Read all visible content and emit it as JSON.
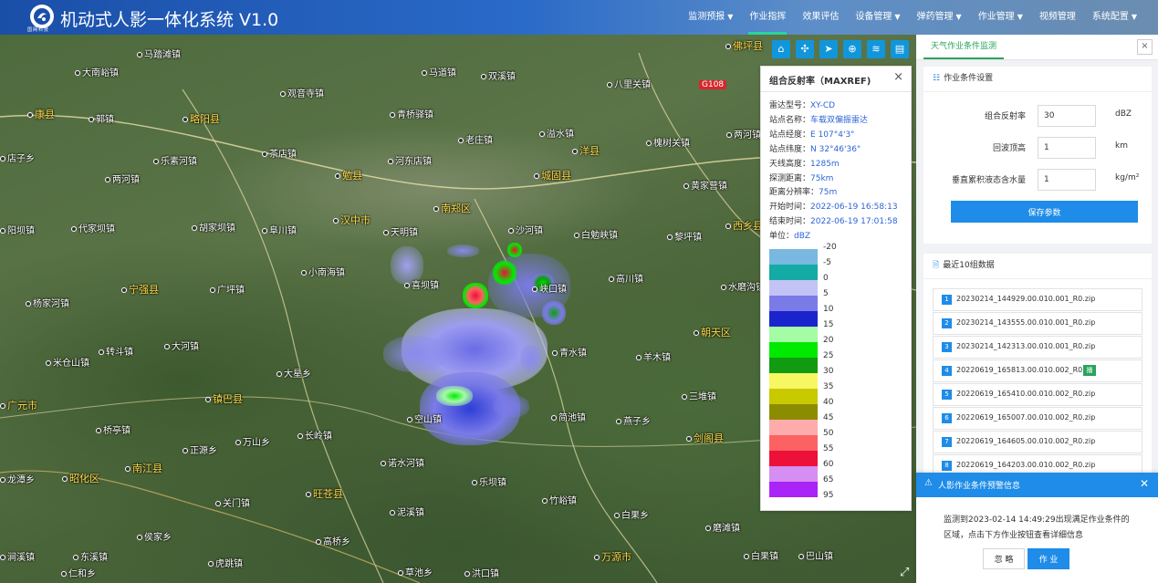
{
  "header": {
    "logo_text": "国网科技",
    "title": "机动式人影一体化系统 V1.0",
    "nav": [
      {
        "label": "监测预报",
        "dropdown": true
      },
      {
        "label": "作业指挥",
        "dropdown": false,
        "active": true
      },
      {
        "label": "效果评估",
        "dropdown": false
      },
      {
        "label": "设备管理",
        "dropdown": true
      },
      {
        "label": "弹药管理",
        "dropdown": true
      },
      {
        "label": "作业管理",
        "dropdown": true
      },
      {
        "label": "视频管理",
        "dropdown": false
      },
      {
        "label": "系统配置",
        "dropdown": true
      }
    ]
  },
  "map": {
    "road_badge": "G108",
    "places": [
      {
        "name": "大南峪镇",
        "type": "town"
      },
      {
        "name": "马踏滩镇",
        "type": "town"
      },
      {
        "name": "马道镇",
        "type": "town"
      },
      {
        "name": "双溪镇",
        "type": "town"
      },
      {
        "name": "八里关镇",
        "type": "town"
      },
      {
        "name": "佛坪县",
        "type": "city"
      },
      {
        "name": "观音寺镇",
        "type": "town"
      },
      {
        "name": "青桥驿镇",
        "type": "town"
      },
      {
        "name": "康县",
        "type": "city"
      },
      {
        "name": "郭镇",
        "type": "town"
      },
      {
        "name": "略阳县",
        "type": "city"
      },
      {
        "name": "老庄镇",
        "type": "town"
      },
      {
        "name": "溢水镇",
        "type": "town"
      },
      {
        "name": "槐树关镇",
        "type": "town"
      },
      {
        "name": "两河镇",
        "type": "town"
      },
      {
        "name": "店子乡",
        "type": "town"
      },
      {
        "name": "乐素河镇",
        "type": "town"
      },
      {
        "name": "茶店镇",
        "type": "town"
      },
      {
        "name": "河东店镇",
        "type": "town"
      },
      {
        "name": "洋县",
        "type": "city"
      },
      {
        "name": "两河镇",
        "type": "town"
      },
      {
        "name": "勉县",
        "type": "city"
      },
      {
        "name": "城固县",
        "type": "city"
      },
      {
        "name": "黄家营镇",
        "type": "town"
      },
      {
        "name": "阳坝镇",
        "type": "town"
      },
      {
        "name": "代家坝镇",
        "type": "town"
      },
      {
        "name": "胡家坝镇",
        "type": "town"
      },
      {
        "name": "阜川镇",
        "type": "town"
      },
      {
        "name": "汉中市",
        "type": "city"
      },
      {
        "name": "南郑区",
        "type": "city"
      },
      {
        "name": "天明镇",
        "type": "town"
      },
      {
        "name": "沙河镇",
        "type": "town"
      },
      {
        "name": "白勉峡镇",
        "type": "town"
      },
      {
        "name": "西乡县",
        "type": "city"
      },
      {
        "name": "黎坪镇",
        "type": "town"
      },
      {
        "name": "小南海镇",
        "type": "town"
      },
      {
        "name": "喜坝镇",
        "type": "town"
      },
      {
        "name": "峡口镇",
        "type": "town"
      },
      {
        "name": "高川镇",
        "type": "town"
      },
      {
        "name": "水磨沟镇",
        "type": "town"
      },
      {
        "name": "宁强县",
        "type": "city"
      },
      {
        "name": "广坪镇",
        "type": "town"
      },
      {
        "name": "杨家河镇",
        "type": "town"
      },
      {
        "name": "朝天区",
        "type": "city"
      },
      {
        "name": "转斗镇",
        "type": "town"
      },
      {
        "name": "大河镇",
        "type": "town"
      },
      {
        "name": "青水镇",
        "type": "town"
      },
      {
        "name": "羊木镇",
        "type": "town"
      },
      {
        "name": "米仓山镇",
        "type": "town"
      },
      {
        "name": "大星乡",
        "type": "town"
      },
      {
        "name": "镇巴县",
        "type": "city"
      },
      {
        "name": "三堆镇",
        "type": "town"
      },
      {
        "name": "广元市",
        "type": "city"
      },
      {
        "name": "桥亭镇",
        "type": "town"
      },
      {
        "name": "空山镇",
        "type": "town"
      },
      {
        "name": "简池镇",
        "type": "town"
      },
      {
        "name": "燕子乡",
        "type": "town"
      },
      {
        "name": "正源乡",
        "type": "town"
      },
      {
        "name": "万山乡",
        "type": "town"
      },
      {
        "name": "长岭镇",
        "type": "town"
      },
      {
        "name": "剑阁县",
        "type": "city"
      },
      {
        "name": "龙潭乡",
        "type": "town"
      },
      {
        "name": "昭化区",
        "type": "city"
      },
      {
        "name": "南江县",
        "type": "city"
      },
      {
        "name": "诺水河镇",
        "type": "town"
      },
      {
        "name": "乐坝镇",
        "type": "town"
      },
      {
        "name": "旺苍县",
        "type": "city"
      },
      {
        "name": "关门镇",
        "type": "town"
      },
      {
        "name": "泥溪镇",
        "type": "town"
      },
      {
        "name": "竹峪镇",
        "type": "town"
      },
      {
        "name": "白果乡",
        "type": "town"
      },
      {
        "name": "磨滩镇",
        "type": "town"
      },
      {
        "name": "侯家乡",
        "type": "town"
      },
      {
        "name": "高桥乡",
        "type": "town"
      },
      {
        "name": "涧溪镇",
        "type": "town"
      },
      {
        "name": "东溪镇",
        "type": "town"
      },
      {
        "name": "虎跳镇",
        "type": "town"
      },
      {
        "name": "仁和乡",
        "type": "town"
      },
      {
        "name": "草池乡",
        "type": "town"
      },
      {
        "name": "洪口镇",
        "type": "town"
      },
      {
        "name": "万源市",
        "type": "city"
      },
      {
        "name": "白果镇",
        "type": "town"
      },
      {
        "name": "巴山镇",
        "type": "town"
      }
    ],
    "tools": [
      "home-icon",
      "satellite-icon",
      "send-icon",
      "globe-icon",
      "layers-icon",
      "table-icon"
    ]
  },
  "radar": {
    "title": "组合反射率（MAXREF)",
    "info": [
      {
        "key": "雷达型号：",
        "value": "XY-CD"
      },
      {
        "key": "站点名称：",
        "value": "车载双偏振雷达"
      },
      {
        "key": "站点经度：",
        "value": "E 107°4'3\""
      },
      {
        "key": "站点纬度：",
        "value": "N 32°46'36\""
      },
      {
        "key": "天线高度：",
        "value": "1285m"
      },
      {
        "key": "探测距离：",
        "value": "75km"
      },
      {
        "key": "距离分辨率：",
        "value": "75m"
      },
      {
        "key": "开始时间：",
        "value": "2022-06-19 16:58:13"
      },
      {
        "key": "结束时间：",
        "value": "2022-06-19 17:01:58"
      },
      {
        "key": "单位：",
        "value": "dBZ"
      }
    ],
    "legend": [
      {
        "value": "-20",
        "color": "#79b8e0"
      },
      {
        "value": "-5",
        "color": "#13aba3"
      },
      {
        "value": "0",
        "color": "#c3c3f5"
      },
      {
        "value": "5",
        "color": "#7b7be8"
      },
      {
        "value": "10",
        "color": "#1a24cc"
      },
      {
        "value": "15",
        "color": "#a4fca4"
      },
      {
        "value": "20",
        "color": "#00ea00"
      },
      {
        "value": "25",
        "color": "#119b11"
      },
      {
        "value": "30",
        "color": "#f7f763"
      },
      {
        "value": "35",
        "color": "#c9c900"
      },
      {
        "value": "40",
        "color": "#8c8c00"
      },
      {
        "value": "45",
        "color": "#fdabab"
      },
      {
        "value": "50",
        "color": "#fc6262"
      },
      {
        "value": "55",
        "color": "#ed1038"
      },
      {
        "value": "60",
        "color": "#d58ef2"
      },
      {
        "value": "65",
        "color": "#ab24f7"
      },
      {
        "value": "95",
        "color": "#ab24f7"
      }
    ]
  },
  "side": {
    "tab": "天气作业条件监测",
    "settings": {
      "title": "作业条件设置",
      "fields": [
        {
          "label": "组合反射率",
          "value": "30",
          "unit": "dBZ"
        },
        {
          "label": "回波顶高",
          "value": "1",
          "unit": "km"
        },
        {
          "label": "垂直累积液态含水量",
          "value": "1",
          "unit": "kg/m²"
        }
      ],
      "save_label": "保存参数"
    },
    "recent": {
      "title": "最近10组数据",
      "files": [
        {
          "num": "1",
          "name": "20230214_144929.00.010.001_R0.zip",
          "tag": ""
        },
        {
          "num": "2",
          "name": "20230214_143555.00.010.001_R0.zip",
          "tag": ""
        },
        {
          "num": "3",
          "name": "20230214_142313.00.010.001_R0.zip",
          "tag": ""
        },
        {
          "num": "4",
          "name": "20220619_165813.00.010.002_R0.zip",
          "tag": "播"
        },
        {
          "num": "5",
          "name": "20220619_165410.00.010.002_R0.zip",
          "tag": ""
        },
        {
          "num": "6",
          "name": "20220619_165007.00.010.002_R0.zip",
          "tag": ""
        },
        {
          "num": "7",
          "name": "20220619_164605.00.010.002_R0.zip",
          "tag": ""
        },
        {
          "num": "8",
          "name": "20220619_164203.00.010.002_R0.zip",
          "tag": ""
        }
      ]
    }
  },
  "warning": {
    "title": "人影作业条件预警信息",
    "message": "监测到2023-02-14 14:49:29出现满足作业条件的区域，点击下方作业按钮查看详细信息",
    "ignore_label": "忽 略",
    "work_label": "作 业"
  }
}
